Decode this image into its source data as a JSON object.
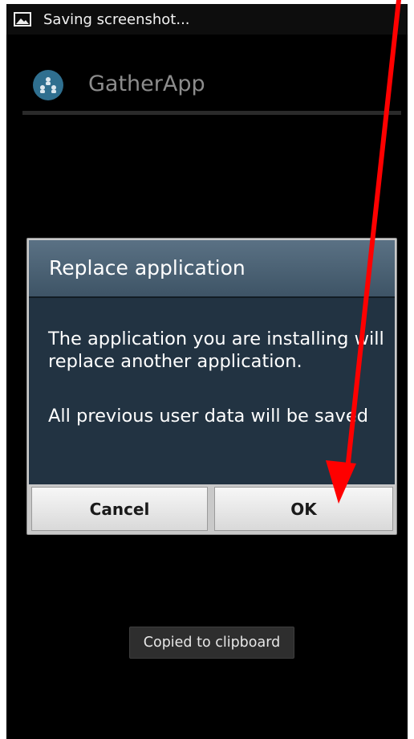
{
  "status_bar": {
    "notification_icon": "image-icon",
    "notification_text": "Saving screenshot..."
  },
  "app_bar": {
    "icon": "people-network-icon",
    "title": "GatherApp"
  },
  "dialog": {
    "title": "Replace application",
    "message": "The application you are installing will replace another application.",
    "note": "All previous user data will be saved",
    "cancel_label": "Cancel",
    "ok_label": "OK"
  },
  "toast": {
    "text": "Copied to clipboard"
  },
  "annotation": {
    "type": "red-arrow",
    "color": "#ff0000",
    "points_to": "ok-button"
  },
  "colors": {
    "dialog_title_bg": "#4d6375",
    "dialog_body_bg": "#223342",
    "app_icon_bg": "#2f6f8f",
    "arrow": "#ff0000"
  }
}
